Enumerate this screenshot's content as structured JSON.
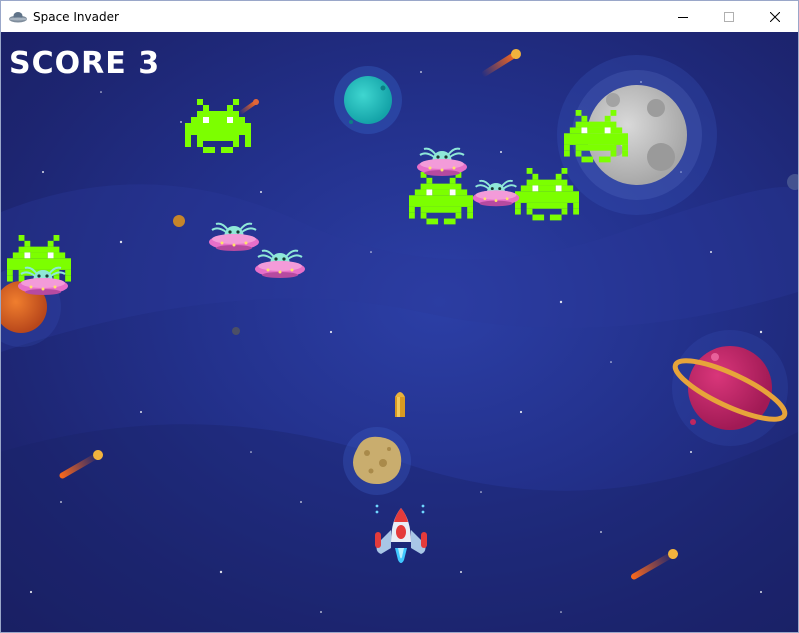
{
  "window": {
    "title": "Space Invader",
    "controls": [
      "minimize",
      "maximize",
      "close"
    ]
  },
  "hud": {
    "score_label": "SCORE",
    "score_value": "3"
  },
  "colors": {
    "background": "#23318c",
    "invader": "#7cff00",
    "score_text": "#ffffff"
  },
  "sprites": {
    "invader": "green-pixel-invader",
    "ufo": "pink-flying-saucer-with-alien",
    "player": "white-rocket-ship",
    "bullet": "yellow-bullet",
    "asteroid": "brown-asteroid"
  }
}
